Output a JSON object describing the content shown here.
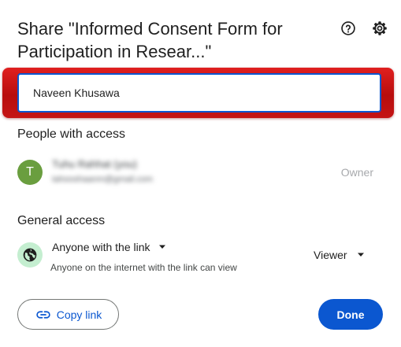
{
  "dialog": {
    "title": "Share \"Informed Consent Form for Participation in Resear...\"",
    "help_icon": "help-circle-icon",
    "settings_icon": "gear-icon"
  },
  "add_people": {
    "value": "Naveen Khusawa",
    "highlight_color": "#d01818",
    "focus_color": "#0b57d0"
  },
  "people_with_access": {
    "heading": "People with access",
    "people": [
      {
        "avatar_letter": "T",
        "avatar_color": "#6a9e3f",
        "name": "Tuhu Rahhat (you)",
        "email": "tahooshaanm@gmail.com",
        "role": "Owner"
      }
    ]
  },
  "general_access": {
    "heading": "General access",
    "icon": "globe-icon",
    "link_setting": "Anyone with the link",
    "description": "Anyone on the internet with the link can view",
    "role": "Viewer"
  },
  "footer": {
    "copy_link_label": "Copy link",
    "copy_link_icon": "link-icon",
    "done_label": "Done"
  }
}
